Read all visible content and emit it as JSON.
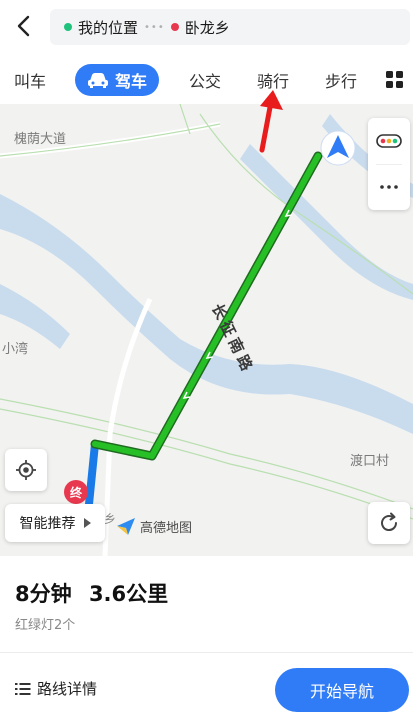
{
  "header": {
    "origin": "我的位置",
    "destination": "卧龙乡",
    "origin_color": "#1ec27b",
    "destination_color": "#e8384f"
  },
  "modes": {
    "taxi": "叫车",
    "drive": "驾车",
    "transit": "公交",
    "ride": "骑行",
    "walk": "步行",
    "selected": "drive",
    "accent": "#2f7cf6"
  },
  "map": {
    "labels": {
      "road_top": "槐荫大道",
      "place_left": "小湾",
      "place_right": "渡口村",
      "route_road": "长征南路",
      "end_marker": "终",
      "dest_partial": "乡"
    },
    "route_color": "#1db41d",
    "logo_text": "高德地图",
    "smart_recommend": "智能推荐"
  },
  "summary": {
    "duration": "8分钟",
    "distance": "3.6公里",
    "traffic_lights": "红绿灯2个"
  },
  "actions": {
    "route_details": "路线详情",
    "start_navigation": "开始导航"
  }
}
